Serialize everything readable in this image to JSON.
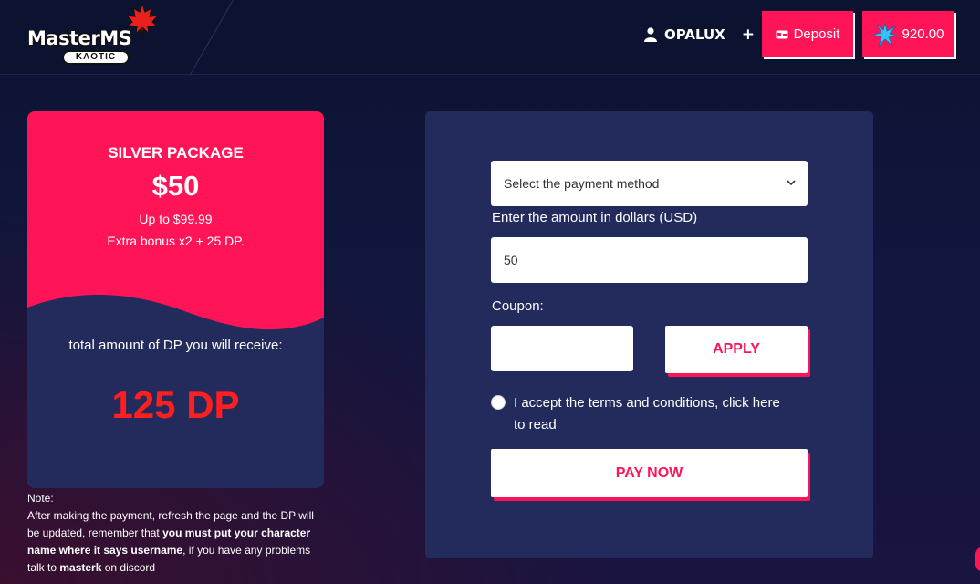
{
  "header": {
    "logo_text": "MasterMS",
    "logo_sub": "KAOTIC",
    "username": "OPALUX",
    "add_icon": "+",
    "deposit_label": "Deposit",
    "balance": "920.00",
    "user_icon": "user-icon",
    "deposit_icon": "wallet-icon",
    "balance_icon": "star-icon"
  },
  "package": {
    "name": "SILVER PACKAGE",
    "price": "$50",
    "range": "Up to $99.99",
    "bonus": "Extra bonus x2 + 25 DP.",
    "total_label": "total amount of DP you will receive:",
    "total_value": "125 DP"
  },
  "note": {
    "title": "Note:",
    "line_a": "After making the payment, refresh the page and the DP will be updated, remember that ",
    "bold_a": "you must put your character name where it says username",
    "line_b": ", if you have any problems talk to ",
    "bold_b": "masterk",
    "line_c": " on discord"
  },
  "form": {
    "payment_placeholder": "Select the payment method",
    "amount_label": "Enter the amount in dollars (USD)",
    "amount_value": "50",
    "coupon_label": "Coupon:",
    "coupon_value": "",
    "apply_label": "APPLY",
    "terms_text": "I accept the terms and conditions, click here to read",
    "pay_label": "PAY NOW"
  },
  "colors": {
    "accent": "#ff1457",
    "panel": "#232a5c",
    "background": "#0c1331",
    "dp_red": "#ff1f1f"
  }
}
